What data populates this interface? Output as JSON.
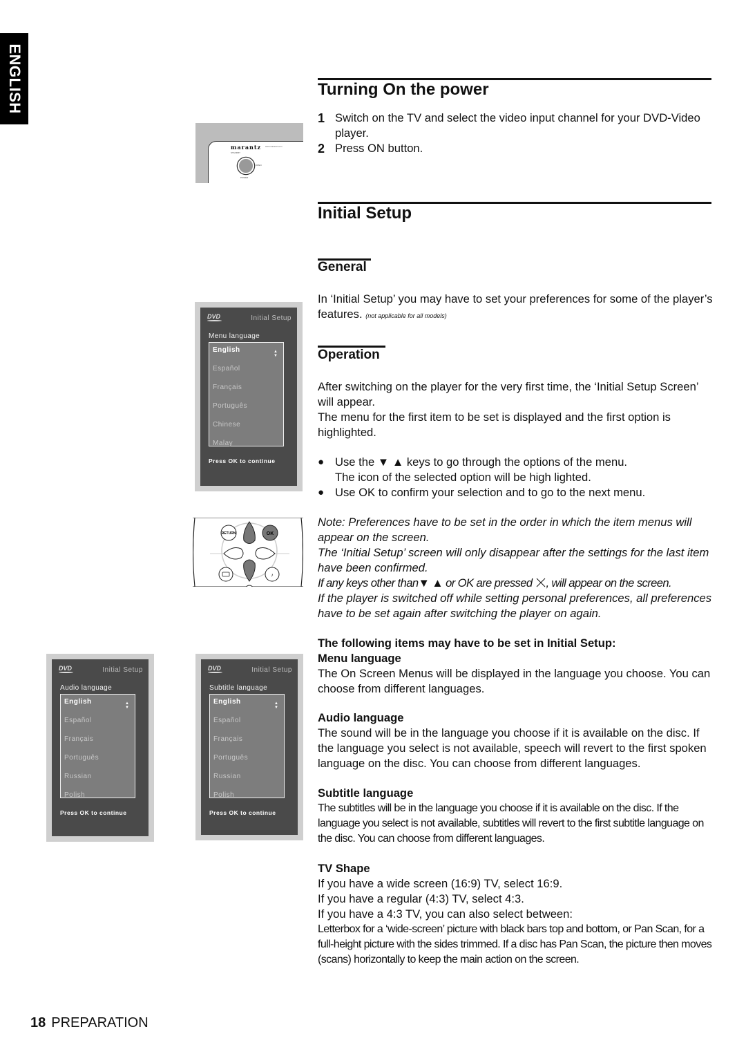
{
  "side_tab": {
    "label": "ENGLISH"
  },
  "turning_on": {
    "heading": "Turning On the power",
    "steps": [
      {
        "num": "1",
        "text": "Switch on the TV and select the video input channel for your DVD-Video player."
      },
      {
        "num": "2",
        "text": "Press ON button."
      }
    ]
  },
  "device_illustration": {
    "brand": "marantz",
    "url": "www.marantz.com",
    "standby_label": "STANDBY",
    "open_label": "OPEN",
    "power_label": "POWER"
  },
  "initial_setup": {
    "heading": "Initial Setup",
    "general": {
      "heading": "General",
      "text": "In ‘Initial Setup’ you may have to set your preferences for some of the player’s features.",
      "note": "(not applicable for all models)"
    },
    "operation": {
      "heading": "Operation",
      "para1": "After switching on the player for the very first time, the ‘Initial Setup Screen’ will appear.",
      "para2": "The menu for the first item to be set is displayed and the first option is highlighted.",
      "bullets": [
        {
          "line1": "Use the ▼ ▲ keys to go through the options of the menu.",
          "line2": "The icon of the selected option will be high lighted."
        },
        {
          "line1": "Use OK to confirm your selection and to go to the next menu.",
          "line2": ""
        }
      ],
      "notes": [
        "Note: Preferences have to be set in the order in which the item menus will appear on the screen.",
        "The ‘Initial Setup’ screen will only disappear after the settings for the last item have been confirmed."
      ],
      "keys_note_before": "If any keys other than▼ ▲ or OK are pressed",
      "keys_note_after": ",  will appear on the screen.",
      "switch_off_note": "If the player is switched off while setting personal preferences, all preferences have to be set again after switching the player on again."
    },
    "items_intro": "The following items may have to be set in Initial Setup:",
    "items": [
      {
        "title": "Menu language",
        "text": " The On Screen Menus will be displayed in the language you choose. You can choose from different languages."
      },
      {
        "title": "Audio language",
        "text": "The sound will be in the language you choose if it is available on the disc. If the language you select is not available, speech will revert to the first spoken language on the disc. You can choose from different languages."
      },
      {
        "title": "Subtitle language",
        "text": "The subtitles will be in the language you choose if it is available on the disc. If the language you select is not available, subtitles will revert to the first subtitle language on the disc. You can choose from different languages."
      },
      {
        "title": "TV Shape",
        "lines": [
          "If you have a wide screen (16:9) TV, select 16:9.",
          "If you have a regular (4:3) TV, select 4:3.",
          "If you have a 4:3 TV, you can also select between:"
        ],
        "text": "Letterbox for a ‘wide-screen’ picture with black bars top and bottom, or Pan Scan, for a full-height picture with the sides trimmed. If a disc has Pan Scan, the picture then moves (scans) horizontally to keep the main action on the screen."
      }
    ]
  },
  "osd_screens": [
    {
      "logo": "DVD",
      "title": "Initial Setup",
      "menu_label": "Menu language",
      "options": [
        "English",
        "Español",
        "Français",
        "Português",
        "Chinese",
        "Malay"
      ],
      "selected": "English",
      "footer": "Press OK to continue"
    },
    {
      "logo": "DVD",
      "title": "Initial Setup",
      "menu_label": "Audio language",
      "options": [
        "English",
        "Español",
        "Français",
        "Português",
        "Russian",
        "Polish"
      ],
      "selected": "English",
      "footer": "Press OK to continue"
    },
    {
      "logo": "DVD",
      "title": "Initial Setup",
      "menu_label": "Subtitle language",
      "options": [
        "English",
        "Español",
        "Français",
        "Português",
        "Russian",
        "Polish"
      ],
      "selected": "English",
      "footer": "Press OK to continue"
    }
  ],
  "remote": {
    "return_label": "RETURN",
    "ok_label": "OK"
  },
  "footer": {
    "page_number": "18",
    "section": "PREPARATION"
  }
}
